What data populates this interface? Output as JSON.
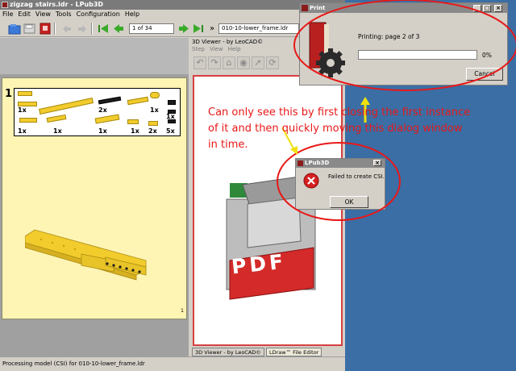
{
  "main_window": {
    "title": "zigzag stairs.ldr - LPub3D",
    "menu": [
      "File",
      "Edit",
      "View",
      "Tools",
      "Configuration",
      "Help"
    ],
    "page_field": "1 of 34",
    "page_nav_more": "»",
    "file_field": "010-10-lower_frame.ldr"
  },
  "instruction_page": {
    "step_number": "1",
    "quantities": [
      "1x",
      "2x",
      "1x",
      "1x",
      "1x",
      "1x",
      "1x",
      "1x",
      "2x",
      "5x"
    ],
    "page_number": "1"
  },
  "viewer": {
    "title": "3D Viewer - by LeoCAD©",
    "menu": [
      "Step",
      "View",
      "Help"
    ],
    "pdf_label": "PDF",
    "tabs": [
      "3D Viewer - by LeoCAD©",
      "LDraw™ File Editor"
    ]
  },
  "status_bar": {
    "text": "Processing model (CSI) for 010-10-lower_frame.ldr"
  },
  "print_dialog": {
    "title": "Print",
    "message": "Printing: page 2 of 3",
    "progress": 0,
    "progress_label": "0%",
    "cancel_label": "Cancel"
  },
  "error_dialog": {
    "title": "LPub3D",
    "message": "Failed to create CSI.",
    "ok_label": "OK"
  },
  "annotation": {
    "text": "Can only see this by first closing the first instance of it and then quickly moving this dialog window in time.",
    "color": "#e81818",
    "arrow_color": "#f0e010"
  },
  "colors": {
    "brick_yellow": "#f2cc2c",
    "page_background": "#fef4b4",
    "desktop": "#3a6ea5"
  }
}
